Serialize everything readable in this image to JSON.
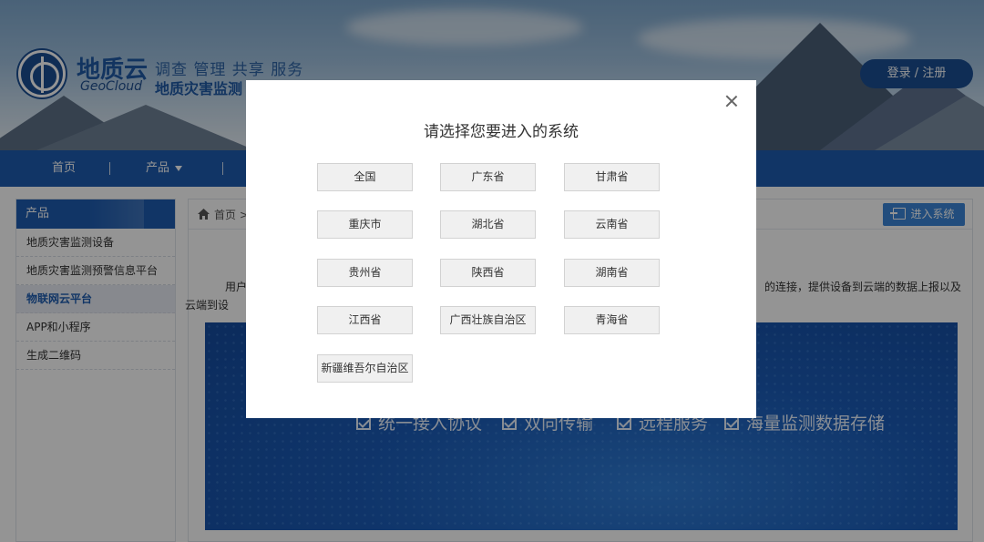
{
  "brand": {
    "name": "地质云",
    "english": "GeoCloud",
    "slogan": "调查 管理 共享 服务",
    "subtitle": "地质灾害监测"
  },
  "header": {
    "login_label": "登录 / 注册"
  },
  "nav": {
    "items": [
      {
        "label": "首页"
      },
      {
        "label": "产品"
      }
    ]
  },
  "sidebar": {
    "heading": "产品",
    "items": [
      {
        "label": "地质灾害监测设备"
      },
      {
        "label": "地质灾害监测预警信息平台"
      },
      {
        "label": "物联网云平台",
        "active": true
      },
      {
        "label": "APP和小程序"
      },
      {
        "label": "生成二维码"
      }
    ]
  },
  "main": {
    "breadcrumb": "首页 >",
    "enter_label": "进入系统",
    "intro_start": "用户",
    "intro_end": "的连接，提供设备到云端的数据上报以及",
    "intro_line2": "云端到设",
    "features": [
      "统一接入协议",
      "双向传输",
      "远程服务",
      "海量监测数据存储"
    ]
  },
  "modal": {
    "title": "请选择您要进入的系统",
    "options": [
      "全国",
      "广东省",
      "甘肃省",
      "重庆市",
      "湖北省",
      "云南省",
      "贵州省",
      "陕西省",
      "湖南省",
      "江西省",
      "广西壮族自治区",
      "青海省",
      "新疆维吾尔自治区"
    ]
  },
  "colors": {
    "brand_blue": "#1e5cb0",
    "accent_blue": "#3b86d8",
    "overlay": "rgba(0,0,0,0.42)"
  }
}
